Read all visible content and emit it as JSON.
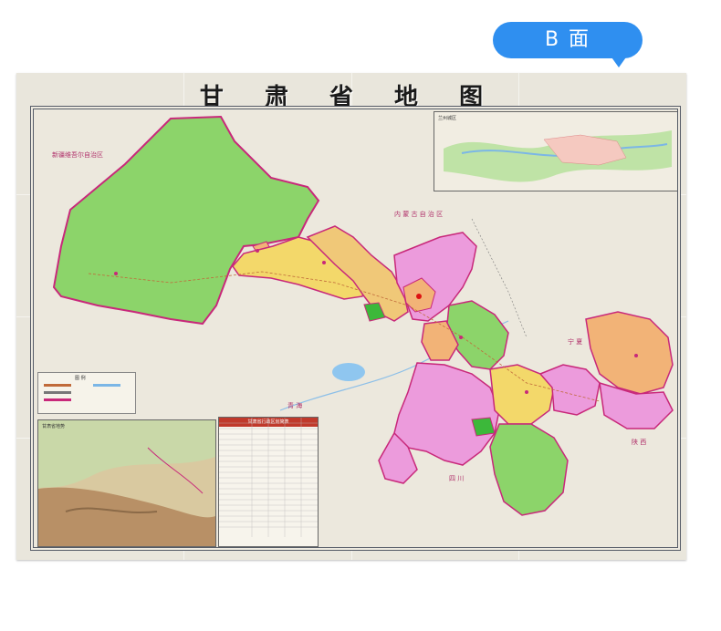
{
  "badge": {
    "label": "B 面"
  },
  "map": {
    "title": "甘 肃 省 地 图",
    "neighbors": {
      "xinjiang": "新疆维吾尔自治区",
      "neimenggu": "内 蒙 古 自 治 区",
      "qinghai": "青 海",
      "sichuan": "四 川",
      "shaanxi": "陕 西",
      "ningxia": "宁 夏"
    },
    "insets": {
      "city_map_title": "兰州城区",
      "legend_title": "图 例",
      "relief_title": "甘肃省地势",
      "table_title": "甘肃省行政区划简表"
    }
  },
  "colors": {
    "badge": "#2f8ff0",
    "green": "#8cd46a",
    "yellow": "#f3d86a",
    "orange": "#f2b377",
    "pink": "#ec9bdc",
    "border": "#c8287a"
  }
}
